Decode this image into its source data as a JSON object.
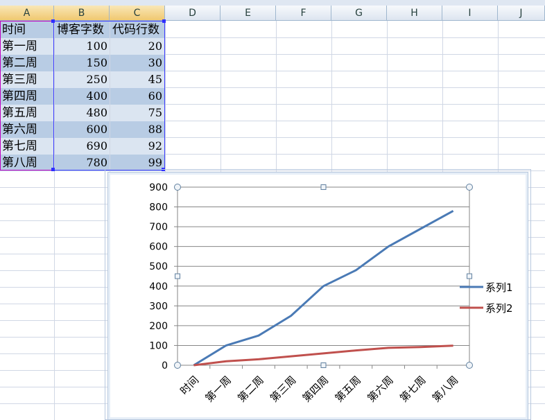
{
  "columns": [
    "A",
    "B",
    "C",
    "D",
    "E",
    "F",
    "G",
    "H",
    "I",
    "J"
  ],
  "table": {
    "header": [
      "时间",
      "博客字数",
      "代码行数"
    ],
    "rows": [
      [
        "第一周",
        "100",
        "20"
      ],
      [
        "第二周",
        "150",
        "30"
      ],
      [
        "第三周",
        "250",
        "45"
      ],
      [
        "第四周",
        "400",
        "60"
      ],
      [
        "第五周",
        "480",
        "75"
      ],
      [
        "第六周",
        "600",
        "88"
      ],
      [
        "第七周",
        "690",
        "92"
      ],
      [
        "第八周",
        "780",
        "99"
      ]
    ]
  },
  "chart_data": {
    "type": "line",
    "categories": [
      "时间",
      "第一周",
      "第二周",
      "第三周",
      "第四周",
      "第五周",
      "第六周",
      "第七周",
      "第八周"
    ],
    "series": [
      {
        "name": "系列1",
        "color": "#4a7ab5",
        "values": [
          null,
          100,
          150,
          250,
          400,
          480,
          600,
          690,
          780
        ]
      },
      {
        "name": "系列2",
        "color": "#c0504d",
        "values": [
          null,
          20,
          30,
          45,
          60,
          75,
          88,
          92,
          99
        ]
      }
    ],
    "y_ticks": [
      "0",
      "100",
      "200",
      "300",
      "400",
      "500",
      "600",
      "700",
      "800",
      "900"
    ],
    "ylim": [
      0,
      900
    ],
    "grid": true,
    "legend": "right"
  }
}
